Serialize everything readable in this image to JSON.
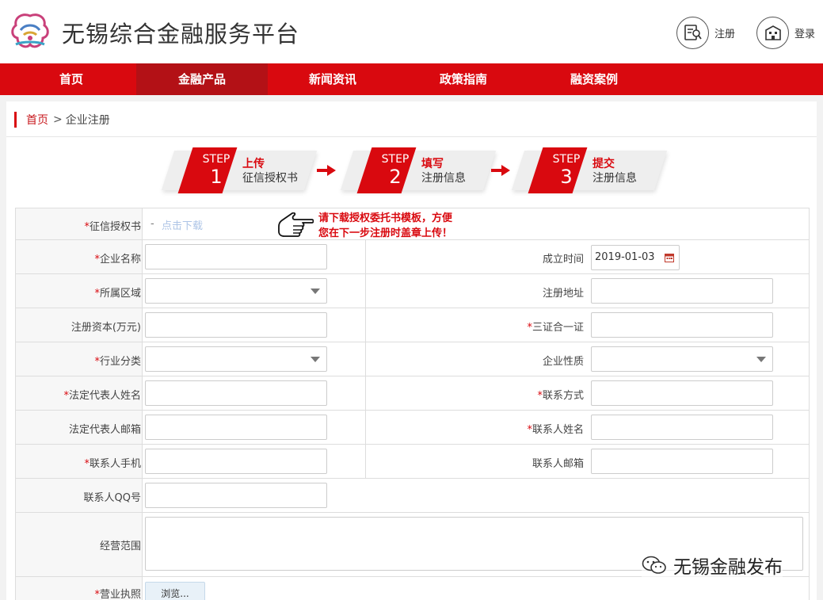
{
  "header": {
    "site_title": "无锡综合金融服务平台",
    "register_label": "注册",
    "login_label": "登录",
    "logo_icon": "wuxi-logo-icon",
    "brand_red": "#d9090f"
  },
  "nav": {
    "items": [
      "首页",
      "金融产品",
      "新闻资讯",
      "政策指南",
      "融资案例"
    ],
    "active_index": 1
  },
  "breadcrumb": {
    "home": "首页",
    "separator": ">",
    "current": "企业注册"
  },
  "steps": [
    {
      "word": "STEP",
      "number": "1",
      "title": "上传",
      "subtitle": "征信授权书"
    },
    {
      "word": "STEP",
      "number": "2",
      "title": "填写",
      "subtitle": "注册信息"
    },
    {
      "word": "STEP",
      "number": "3",
      "title": "提交",
      "subtitle": "注册信息"
    }
  ],
  "form": {
    "credit_auth": {
      "label": "征信授权书",
      "link": "点击下载",
      "dash": "-"
    },
    "notice_line1": "请下载授权委托书模板，方便",
    "notice_line2": "您在下一步注册时盖章上传！",
    "company_name": {
      "label": "企业名称",
      "value": ""
    },
    "found_date": {
      "label": "成立时间",
      "value": "2019-01-03"
    },
    "region": {
      "label": "所属区域",
      "value": ""
    },
    "reg_address": {
      "label": "注册地址",
      "value": ""
    },
    "reg_capital": {
      "label": "注册资本(万元)",
      "value": ""
    },
    "credit_code": {
      "label": "三证合一证",
      "value": ""
    },
    "industry": {
      "label": "行业分类",
      "value": ""
    },
    "nature": {
      "label": "企业性质",
      "value": ""
    },
    "legal_name": {
      "label": "法定代表人姓名",
      "value": ""
    },
    "contact_method": {
      "label": "联系方式",
      "value": ""
    },
    "legal_email": {
      "label": "法定代表人邮箱",
      "value": ""
    },
    "contact_name": {
      "label": "联系人姓名",
      "value": ""
    },
    "contact_phone": {
      "label": "联系人手机",
      "value": ""
    },
    "contact_email": {
      "label": "联系人邮箱",
      "value": ""
    },
    "contact_qq": {
      "label": "联系人QQ号",
      "value": ""
    },
    "business_scope": {
      "label": "经营范围",
      "value": ""
    },
    "license": {
      "label": "营业执照",
      "button": "浏览..."
    },
    "required_mark": "*"
  },
  "watermark": {
    "text": "无锡金融发布",
    "icon": "wechat-icon"
  }
}
